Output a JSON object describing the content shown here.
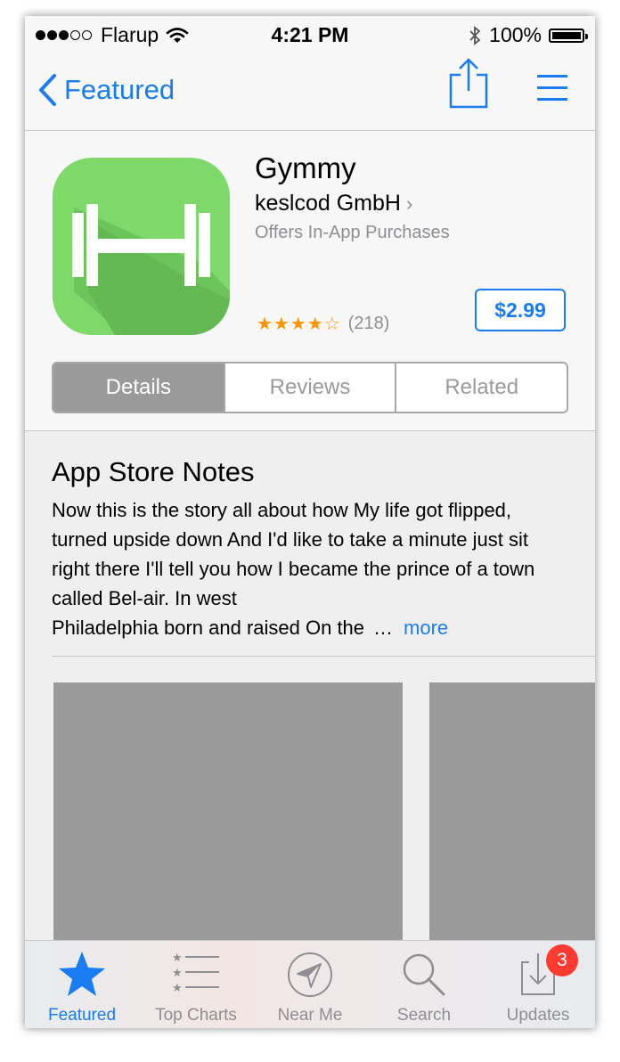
{
  "status_bar": {
    "carrier": "Flarup",
    "time": "4:21 PM",
    "battery": "100%",
    "signal_bars_filled": 3,
    "signal_bars_total": 5
  },
  "nav": {
    "back_label": "Featured",
    "icons": [
      "chevron-left-icon",
      "share-icon",
      "list-icon"
    ]
  },
  "app": {
    "name": "Gymmy",
    "developer": "keslcod GmbH",
    "iap_note": "Offers In-App Purchases",
    "stars": "★★★★☆",
    "star_rating": 4,
    "rating_count": "(218)",
    "price": "$2.99",
    "icon_color": "#7fd86a"
  },
  "segments": {
    "items": [
      "Details",
      "Reviews",
      "Related"
    ],
    "selected": "Details"
  },
  "notes": {
    "title": "App Store Notes",
    "body": "Now this is the story all about how My life got flipped, turned upside down And I'd like to take a minute just sit right there I'll tell you how I became the prince of a town called Bel-air. In west",
    "last_line": "Philadelphia born and raised On the",
    "ellipsis": "…",
    "more_label": "more"
  },
  "tabbar": {
    "items": [
      {
        "label": "Featured",
        "icon": "star-icon",
        "active": true
      },
      {
        "label": "Top Charts",
        "icon": "list-stars-icon",
        "active": false
      },
      {
        "label": "Near Me",
        "icon": "location-arrow-icon",
        "active": false
      },
      {
        "label": "Search",
        "icon": "magnifier-icon",
        "active": false
      },
      {
        "label": "Updates",
        "icon": "download-tray-icon",
        "active": false,
        "badge": "3"
      }
    ]
  },
  "colors": {
    "accent": "#1a7cf2",
    "star": "#ff9500",
    "badge": "#ff3b30",
    "placeholder": "#9a9a9a"
  }
}
